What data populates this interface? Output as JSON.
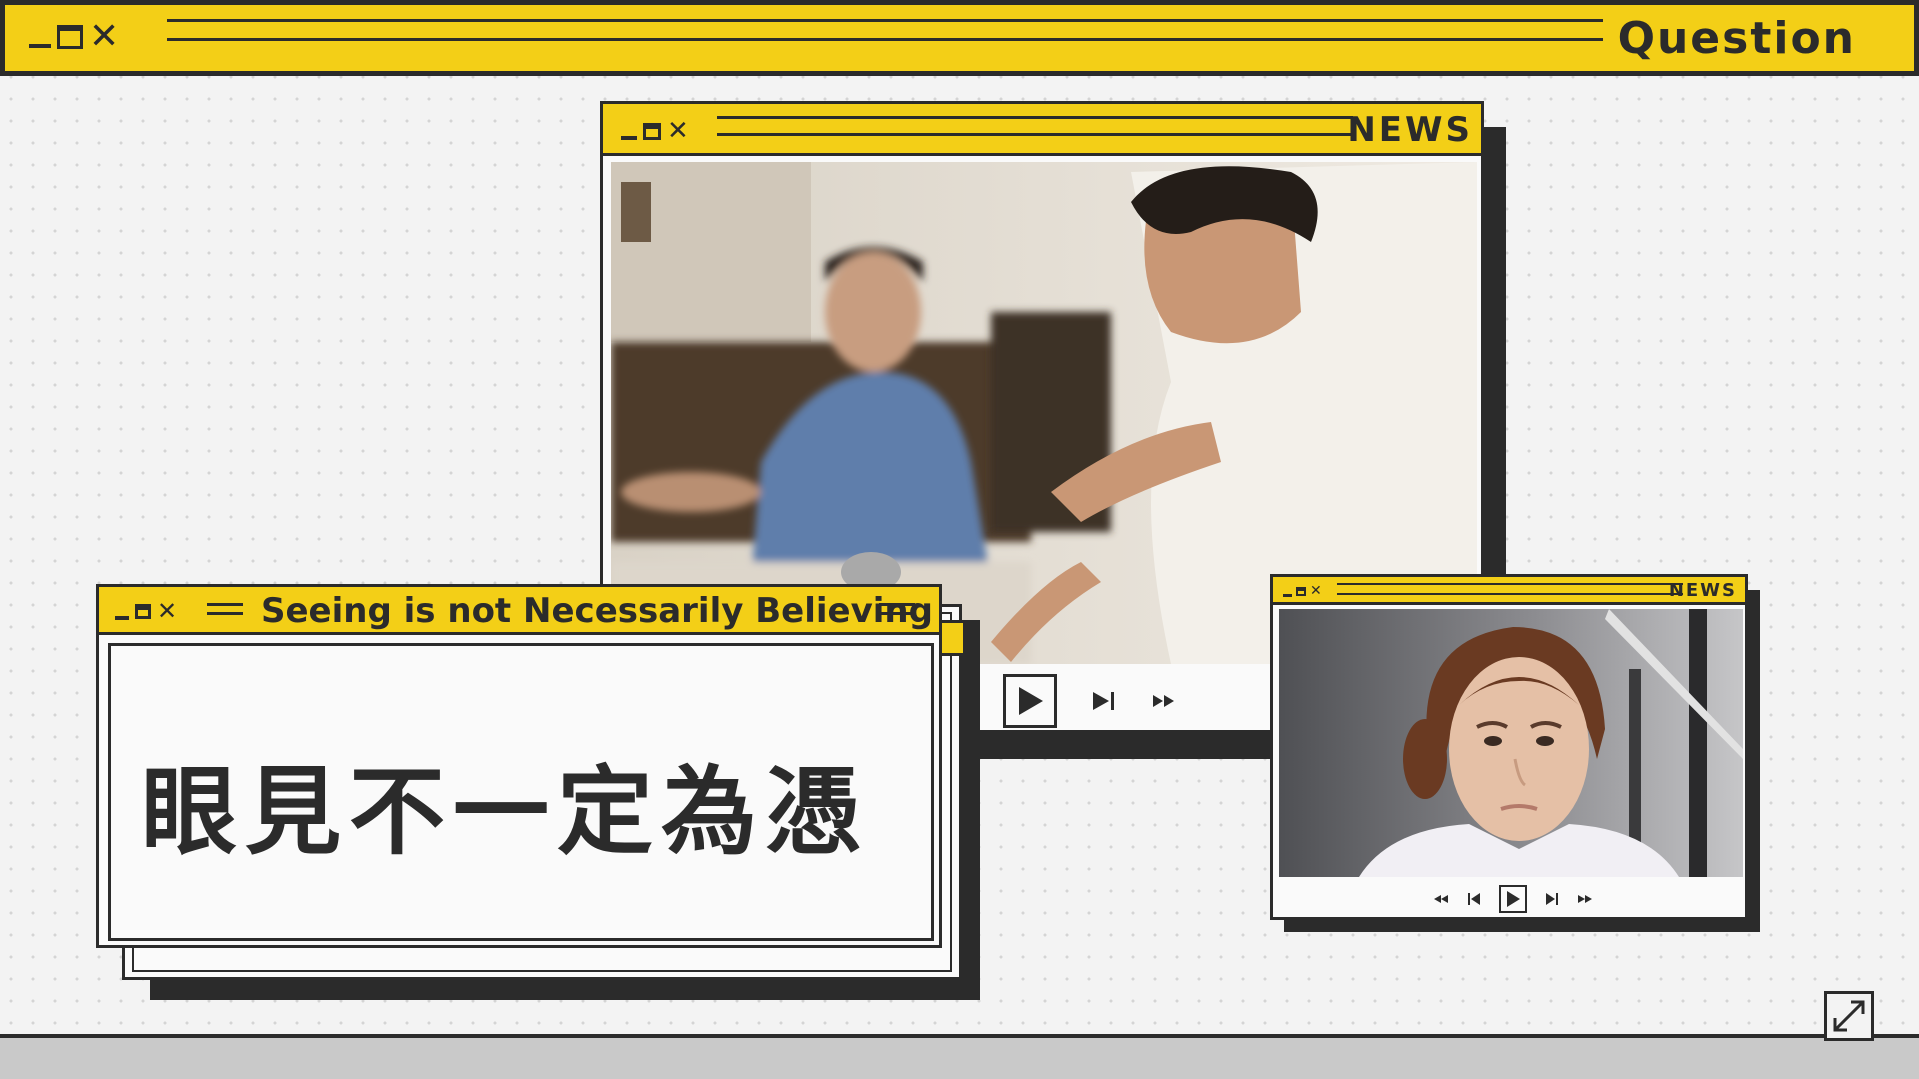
{
  "top_bar": {
    "title": "Question",
    "controls": [
      "minimize-icon",
      "maximize-icon",
      "close-icon"
    ]
  },
  "news_main": {
    "title": "NEWS",
    "controls": [
      "minimize-icon",
      "maximize-icon",
      "close-icon"
    ],
    "media_controls": [
      "previous-icon",
      "play-icon",
      "next-icon",
      "fast-forward-icon"
    ]
  },
  "caption_window": {
    "title": "Seeing is not Necessarily Believing",
    "text": "眼見不一定為憑"
  },
  "news_small": {
    "title": "NEWS",
    "media_controls": [
      "rewind-icon",
      "previous-icon",
      "play-icon",
      "next-icon",
      "fast-forward-icon"
    ]
  },
  "colors": {
    "accent_yellow": "#f3cf17",
    "ink": "#2b2b2b",
    "background": "#f3f3f3",
    "bottom_bar": "#c9c9c9"
  },
  "bottom": {
    "expand_icon": "expand-diagonal-icon"
  }
}
